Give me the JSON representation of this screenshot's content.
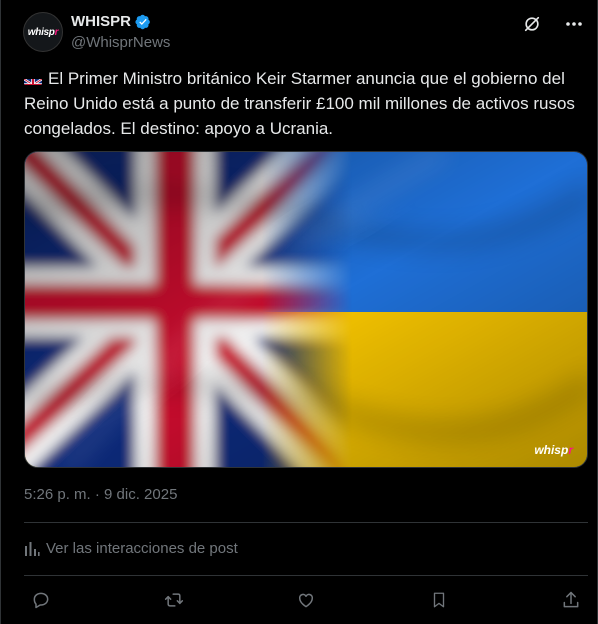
{
  "author": {
    "display_name": "WHISPR",
    "handle": "@WhisprNews",
    "avatar_text": "whisp",
    "avatar_text_accent": "r",
    "verified": true
  },
  "post": {
    "flag_emoji": "gb-flag",
    "text": "El Primer Ministro británico Keir Starmer anuncia que el gobierno del Reino Unido está a punto de transferir £100 mil millones de activos rusos congelados. El destino: apoyo a Ucrania.",
    "media_watermark": "whisp",
    "media_watermark_accent": "r",
    "timestamp": "5:26 p. m. · 9 dic. 2025"
  },
  "analytics": {
    "label": "Ver las interacciones de post"
  },
  "icons": {
    "top": [
      "grok-icon",
      "more-icon"
    ],
    "actions": [
      "reply-icon",
      "repost-icon",
      "like-icon",
      "bookmark-icon",
      "share-icon"
    ]
  },
  "colors": {
    "background": "#000000",
    "text": "#e7e9ea",
    "muted": "#71767b",
    "verified": "#1d9bf0",
    "divider": "#2f3336",
    "ukraine_blue": "#1f6fd6",
    "ukraine_yellow": "#f5c400",
    "uk_red": "#c8102e",
    "uk_blue": "#0d2a7a"
  }
}
